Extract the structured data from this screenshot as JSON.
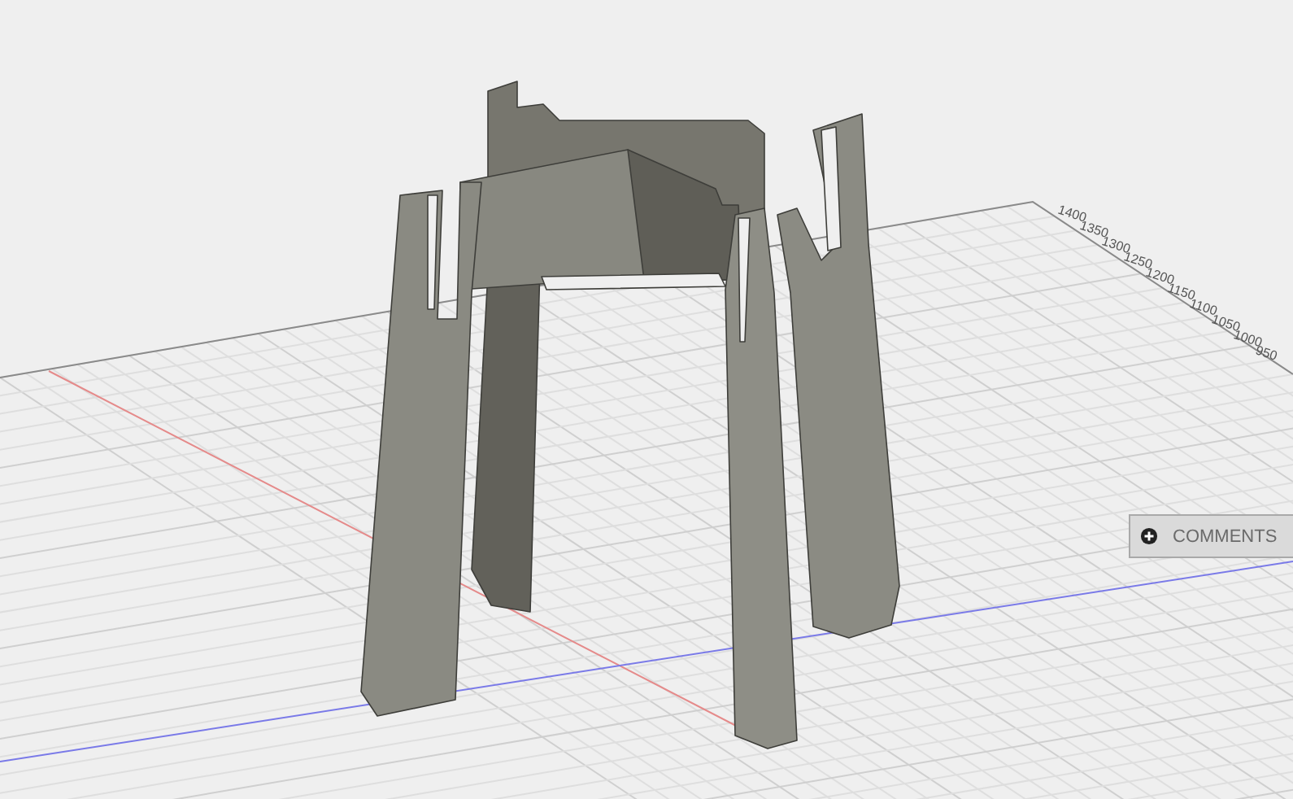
{
  "viewport": {
    "ruler_labels": [
      "1400",
      "1350",
      "1300",
      "1250",
      "1200",
      "1150",
      "1100",
      "1050",
      "1000",
      "950"
    ]
  },
  "comments_panel": {
    "label": "COMMENTS"
  }
}
